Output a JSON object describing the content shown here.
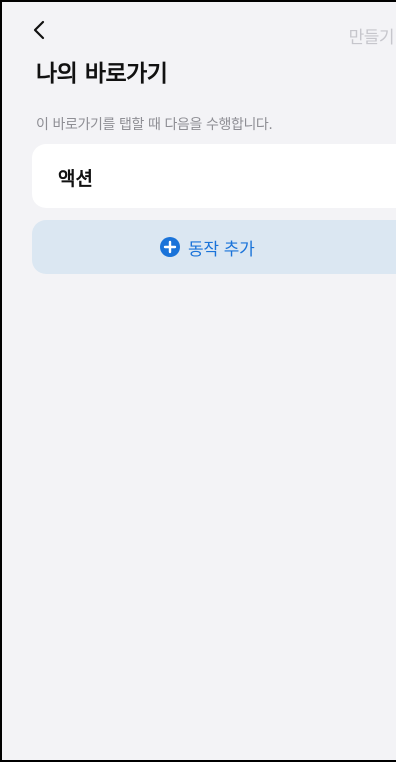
{
  "header": {
    "back_icon": "chevron-left-icon",
    "create_label": "만들기",
    "title": "나의 바로가기"
  },
  "main": {
    "hint": "이 바로가기를 탭할 때 다음을 수행합니다.",
    "action_card_title": "액션",
    "add_action": {
      "icon": "plus-circle-icon",
      "label": "동작 추가"
    }
  },
  "colors": {
    "background": "#f3f3f6",
    "card": "#ffffff",
    "add_button_bg": "#dbe7f2",
    "accent": "#1a73d9",
    "muted_text": "#8e8e94",
    "disabled_text": "#c6c6cc"
  }
}
